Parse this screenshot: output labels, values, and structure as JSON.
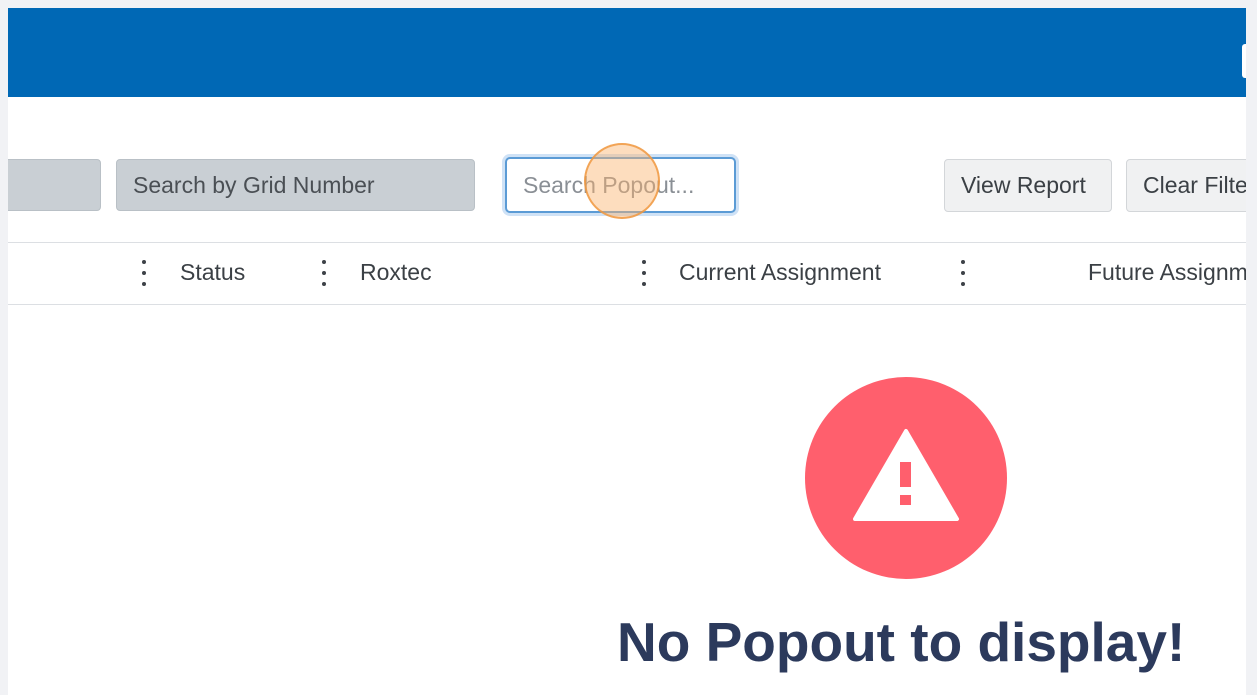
{
  "toolbar": {
    "grid_search_placeholder": "Search by Grid Number",
    "popout_search_placeholder": "Search Popout...",
    "view_report_label": "View Report",
    "clear_filters_label": "Clear Filte"
  },
  "table": {
    "columns": [
      "Status",
      "Roxtec",
      "Current Assignment",
      "Future Assignm"
    ]
  },
  "empty_state": {
    "icon": "warning-icon",
    "message": "No Popout to display!"
  },
  "colors": {
    "topbar": "#0068b5",
    "warning": "#ff5f6d",
    "message": "#2c3a5c"
  }
}
